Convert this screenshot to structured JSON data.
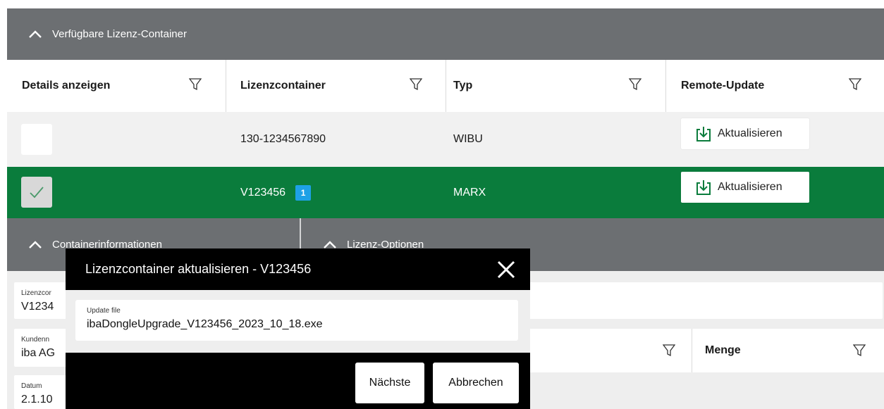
{
  "top_section": {
    "title": "Verfügbare Lizenz-Container"
  },
  "columns": [
    {
      "label": "Details anzeigen"
    },
    {
      "label": "Lizenzcontainer"
    },
    {
      "label": "Typ"
    },
    {
      "label": "Remote-Update"
    }
  ],
  "rows": [
    {
      "checked": false,
      "container": "130-1234567890",
      "badge": "",
      "type": "WIBU",
      "update_label": "Aktualisieren"
    },
    {
      "checked": true,
      "container": "V123456",
      "badge": "1",
      "type": "MARX",
      "update_label": "Aktualisieren"
    }
  ],
  "detail_section": {
    "left_title": "Containerinformationen",
    "right_title": "Lizenz-Optionen"
  },
  "details": {
    "lizenz_label": "Lizenzcor",
    "lizenz_value": "V1234",
    "kunde_label": "Kundenn",
    "kunde_value": "iba AG",
    "datum_label": "Datum",
    "datum_value": "2.1.10",
    "menge_label": "Menge"
  },
  "modal": {
    "title": "Lizenzcontainer aktualisieren - V123456",
    "field_label": "Update file",
    "field_value": "ibaDongleUpgrade_V123456_2023_10_18.exe",
    "next_label": "Nächste",
    "cancel_label": "Abbrechen"
  },
  "colors": {
    "header_gray": "#6c6f72",
    "selected_green": "#0a7c3c",
    "badge_blue": "#1ea1e6"
  }
}
